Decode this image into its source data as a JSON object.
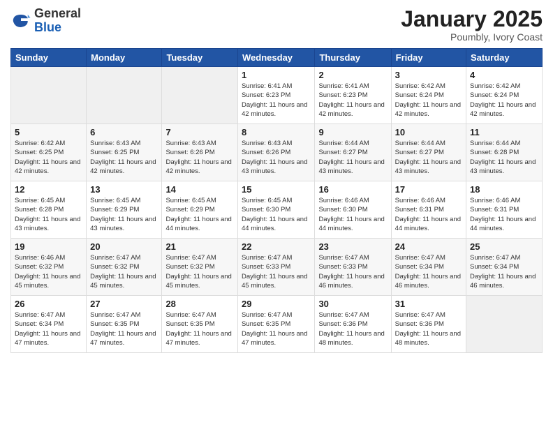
{
  "logo": {
    "general": "General",
    "blue": "Blue"
  },
  "header": {
    "title": "January 2025",
    "subtitle": "Poumbly, Ivory Coast"
  },
  "weekdays": [
    "Sunday",
    "Monday",
    "Tuesday",
    "Wednesday",
    "Thursday",
    "Friday",
    "Saturday"
  ],
  "weeks": [
    [
      {
        "day": "",
        "sunrise": "",
        "sunset": "",
        "daylight": ""
      },
      {
        "day": "",
        "sunrise": "",
        "sunset": "",
        "daylight": ""
      },
      {
        "day": "",
        "sunrise": "",
        "sunset": "",
        "daylight": ""
      },
      {
        "day": "1",
        "sunrise": "Sunrise: 6:41 AM",
        "sunset": "Sunset: 6:23 PM",
        "daylight": "Daylight: 11 hours and 42 minutes."
      },
      {
        "day": "2",
        "sunrise": "Sunrise: 6:41 AM",
        "sunset": "Sunset: 6:23 PM",
        "daylight": "Daylight: 11 hours and 42 minutes."
      },
      {
        "day": "3",
        "sunrise": "Sunrise: 6:42 AM",
        "sunset": "Sunset: 6:24 PM",
        "daylight": "Daylight: 11 hours and 42 minutes."
      },
      {
        "day": "4",
        "sunrise": "Sunrise: 6:42 AM",
        "sunset": "Sunset: 6:24 PM",
        "daylight": "Daylight: 11 hours and 42 minutes."
      }
    ],
    [
      {
        "day": "5",
        "sunrise": "Sunrise: 6:42 AM",
        "sunset": "Sunset: 6:25 PM",
        "daylight": "Daylight: 11 hours and 42 minutes."
      },
      {
        "day": "6",
        "sunrise": "Sunrise: 6:43 AM",
        "sunset": "Sunset: 6:25 PM",
        "daylight": "Daylight: 11 hours and 42 minutes."
      },
      {
        "day": "7",
        "sunrise": "Sunrise: 6:43 AM",
        "sunset": "Sunset: 6:26 PM",
        "daylight": "Daylight: 11 hours and 42 minutes."
      },
      {
        "day": "8",
        "sunrise": "Sunrise: 6:43 AM",
        "sunset": "Sunset: 6:26 PM",
        "daylight": "Daylight: 11 hours and 43 minutes."
      },
      {
        "day": "9",
        "sunrise": "Sunrise: 6:44 AM",
        "sunset": "Sunset: 6:27 PM",
        "daylight": "Daylight: 11 hours and 43 minutes."
      },
      {
        "day": "10",
        "sunrise": "Sunrise: 6:44 AM",
        "sunset": "Sunset: 6:27 PM",
        "daylight": "Daylight: 11 hours and 43 minutes."
      },
      {
        "day": "11",
        "sunrise": "Sunrise: 6:44 AM",
        "sunset": "Sunset: 6:28 PM",
        "daylight": "Daylight: 11 hours and 43 minutes."
      }
    ],
    [
      {
        "day": "12",
        "sunrise": "Sunrise: 6:45 AM",
        "sunset": "Sunset: 6:28 PM",
        "daylight": "Daylight: 11 hours and 43 minutes."
      },
      {
        "day": "13",
        "sunrise": "Sunrise: 6:45 AM",
        "sunset": "Sunset: 6:29 PM",
        "daylight": "Daylight: 11 hours and 43 minutes."
      },
      {
        "day": "14",
        "sunrise": "Sunrise: 6:45 AM",
        "sunset": "Sunset: 6:29 PM",
        "daylight": "Daylight: 11 hours and 44 minutes."
      },
      {
        "day": "15",
        "sunrise": "Sunrise: 6:45 AM",
        "sunset": "Sunset: 6:30 PM",
        "daylight": "Daylight: 11 hours and 44 minutes."
      },
      {
        "day": "16",
        "sunrise": "Sunrise: 6:46 AM",
        "sunset": "Sunset: 6:30 PM",
        "daylight": "Daylight: 11 hours and 44 minutes."
      },
      {
        "day": "17",
        "sunrise": "Sunrise: 6:46 AM",
        "sunset": "Sunset: 6:31 PM",
        "daylight": "Daylight: 11 hours and 44 minutes."
      },
      {
        "day": "18",
        "sunrise": "Sunrise: 6:46 AM",
        "sunset": "Sunset: 6:31 PM",
        "daylight": "Daylight: 11 hours and 44 minutes."
      }
    ],
    [
      {
        "day": "19",
        "sunrise": "Sunrise: 6:46 AM",
        "sunset": "Sunset: 6:32 PM",
        "daylight": "Daylight: 11 hours and 45 minutes."
      },
      {
        "day": "20",
        "sunrise": "Sunrise: 6:47 AM",
        "sunset": "Sunset: 6:32 PM",
        "daylight": "Daylight: 11 hours and 45 minutes."
      },
      {
        "day": "21",
        "sunrise": "Sunrise: 6:47 AM",
        "sunset": "Sunset: 6:32 PM",
        "daylight": "Daylight: 11 hours and 45 minutes."
      },
      {
        "day": "22",
        "sunrise": "Sunrise: 6:47 AM",
        "sunset": "Sunset: 6:33 PM",
        "daylight": "Daylight: 11 hours and 45 minutes."
      },
      {
        "day": "23",
        "sunrise": "Sunrise: 6:47 AM",
        "sunset": "Sunset: 6:33 PM",
        "daylight": "Daylight: 11 hours and 46 minutes."
      },
      {
        "day": "24",
        "sunrise": "Sunrise: 6:47 AM",
        "sunset": "Sunset: 6:34 PM",
        "daylight": "Daylight: 11 hours and 46 minutes."
      },
      {
        "day": "25",
        "sunrise": "Sunrise: 6:47 AM",
        "sunset": "Sunset: 6:34 PM",
        "daylight": "Daylight: 11 hours and 46 minutes."
      }
    ],
    [
      {
        "day": "26",
        "sunrise": "Sunrise: 6:47 AM",
        "sunset": "Sunset: 6:34 PM",
        "daylight": "Daylight: 11 hours and 47 minutes."
      },
      {
        "day": "27",
        "sunrise": "Sunrise: 6:47 AM",
        "sunset": "Sunset: 6:35 PM",
        "daylight": "Daylight: 11 hours and 47 minutes."
      },
      {
        "day": "28",
        "sunrise": "Sunrise: 6:47 AM",
        "sunset": "Sunset: 6:35 PM",
        "daylight": "Daylight: 11 hours and 47 minutes."
      },
      {
        "day": "29",
        "sunrise": "Sunrise: 6:47 AM",
        "sunset": "Sunset: 6:35 PM",
        "daylight": "Daylight: 11 hours and 47 minutes."
      },
      {
        "day": "30",
        "sunrise": "Sunrise: 6:47 AM",
        "sunset": "Sunset: 6:36 PM",
        "daylight": "Daylight: 11 hours and 48 minutes."
      },
      {
        "day": "31",
        "sunrise": "Sunrise: 6:47 AM",
        "sunset": "Sunset: 6:36 PM",
        "daylight": "Daylight: 11 hours and 48 minutes."
      },
      {
        "day": "",
        "sunrise": "",
        "sunset": "",
        "daylight": ""
      }
    ]
  ]
}
